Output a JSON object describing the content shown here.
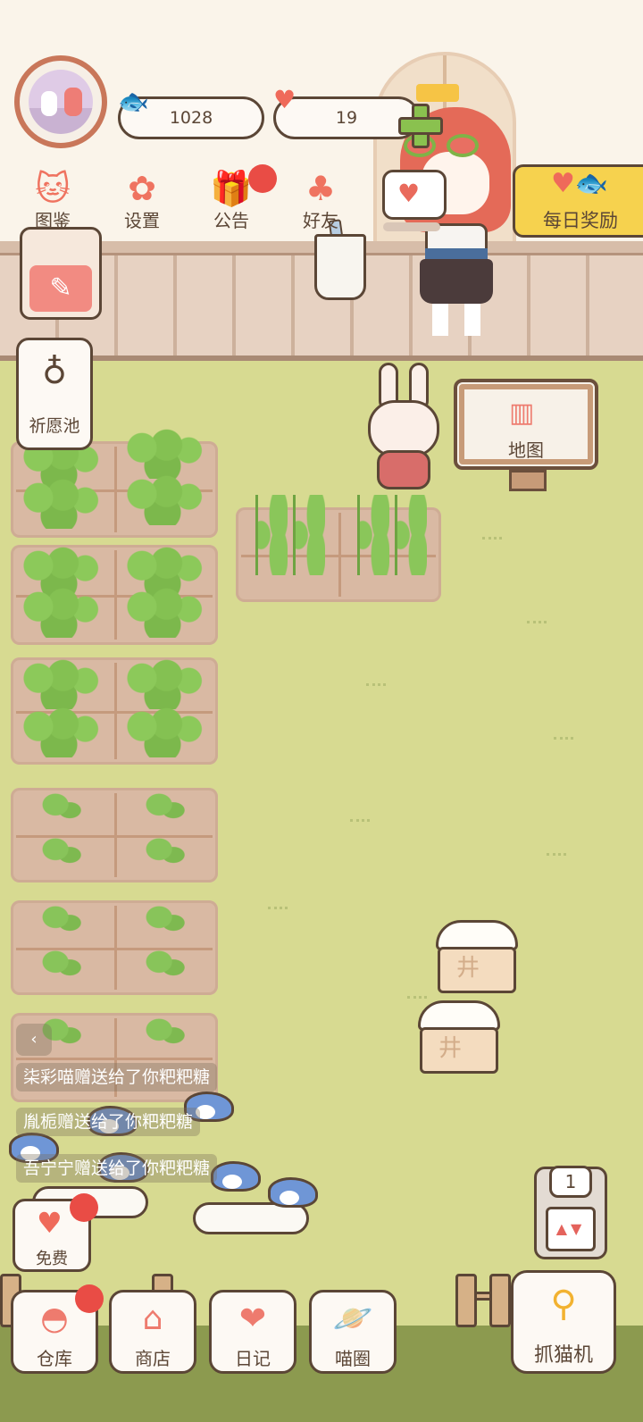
{
  "hud": {
    "fish_count": "1028",
    "heart_count": "19"
  },
  "top_menu": [
    {
      "label": "图鉴",
      "icon": "cat-book-icon"
    },
    {
      "label": "设置",
      "icon": "gear-icon"
    },
    {
      "label": "公告",
      "icon": "gift-icon"
    },
    {
      "label": "好友",
      "icon": "friends-icon"
    }
  ],
  "daily_reward": {
    "label": "每日奖励",
    "icon": "heart-fish-icon"
  },
  "side": {
    "wish_pool_label": "祈愿池",
    "map_label": "地图"
  },
  "chat_messages": [
    "柒彩喵赠送给了你粑粑糖",
    "胤栀赠送给了你粑粑糖",
    "吾宁宁赠送给了你粑粑糖"
  ],
  "free_label": "免费",
  "machine_counter": "1",
  "bottom_nav": [
    {
      "label": "仓库",
      "icon": "storage-icon"
    },
    {
      "label": "商店",
      "icon": "shop-icon"
    },
    {
      "label": "日记",
      "icon": "diary-icon"
    },
    {
      "label": "喵圈",
      "icon": "cat-planet-icon"
    }
  ],
  "claw_machine_label": "抓猫机",
  "colors": {
    "grass": "#d7da91",
    "outline": "#5b4636",
    "accent_red": "#e94c45",
    "accent_yellow": "#f6d24e"
  }
}
